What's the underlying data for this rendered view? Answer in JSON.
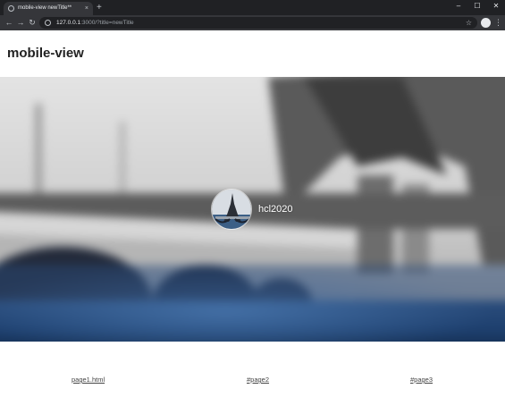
{
  "browser": {
    "tab_title": "mobile-view newTitle**",
    "tab_close": "×",
    "new_tab": "+",
    "url_host": "127.0.0.1",
    "url_rest": ":3000/?title=newTitle",
    "window_controls": {
      "minimize": "–",
      "maximize": "☐",
      "close": "✕"
    }
  },
  "page": {
    "title": "mobile-view",
    "profile": {
      "username": "hcl2020"
    },
    "nav_links": [
      {
        "label": "page1.html"
      },
      {
        "label": "#page2"
      },
      {
        "label": "#page3"
      }
    ]
  },
  "colors": {
    "chrome_dark": "#202124",
    "chrome_toolbar": "#35363a",
    "page_bg": "#ffffff",
    "water_blue": "#1d3f6e"
  }
}
